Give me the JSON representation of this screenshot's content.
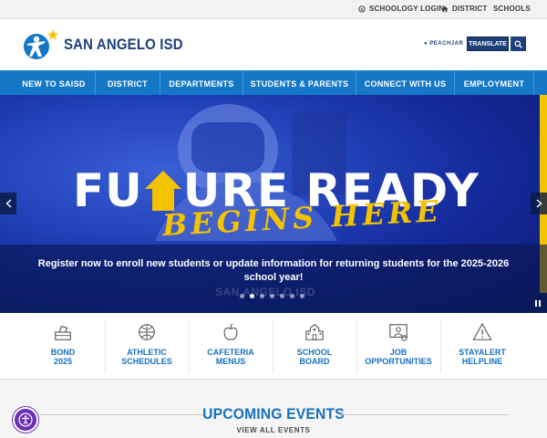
{
  "utility": {
    "schoology": "SCHOOLOGY LOGIN",
    "district": "DISTRICT",
    "schools": "SCHOOLS"
  },
  "header": {
    "brand": "SAN ANGELO ISD",
    "peachjar": "PEACHJAR",
    "translate": "TRANSLATE"
  },
  "nav": [
    {
      "label": "NEW TO SAISD"
    },
    {
      "label": "DISTRICT"
    },
    {
      "label": "DEPARTMENTS"
    },
    {
      "label": "STUDENTS & PARENTS"
    },
    {
      "label": "CONNECT WITH US"
    },
    {
      "label": "EMPLOYMENT"
    }
  ],
  "hero": {
    "headline_left": "FU",
    "headline_right": "URE READY",
    "script": "BEGINS HERE",
    "caption": "Register now to enroll new students or update information for returning students for the 2025-2026 school year!",
    "watermark": "SAN ANGELO ISD",
    "slide_count": 7,
    "active_slide": 2
  },
  "quick_links": [
    {
      "line1": "BOND",
      "line2": "2025",
      "icon": "ballot-icon"
    },
    {
      "line1": "ATHLETIC",
      "line2": "SCHEDULES",
      "icon": "sports-balls-icon"
    },
    {
      "line1": "CAFETERIA",
      "line2": "MENUS",
      "icon": "apple-icon"
    },
    {
      "line1": "SCHOOL",
      "line2": "BOARD",
      "icon": "school-building-icon"
    },
    {
      "line1": "JOB",
      "line2": "OPPORTUNITIES",
      "icon": "job-person-icon"
    },
    {
      "line1": "STAYALERT",
      "line2": "HELPLINE",
      "icon": "warning-icon"
    }
  ],
  "events": {
    "title": "UPCOMING EVENTS",
    "view_all": "VIEW ALL EVENTS"
  },
  "colors": {
    "navy": "#1d3f7a",
    "nav_blue": "#1578c6",
    "link_blue": "#1671c0",
    "yellow": "#f3c300",
    "a11y_purple": "#6b2fb3"
  }
}
